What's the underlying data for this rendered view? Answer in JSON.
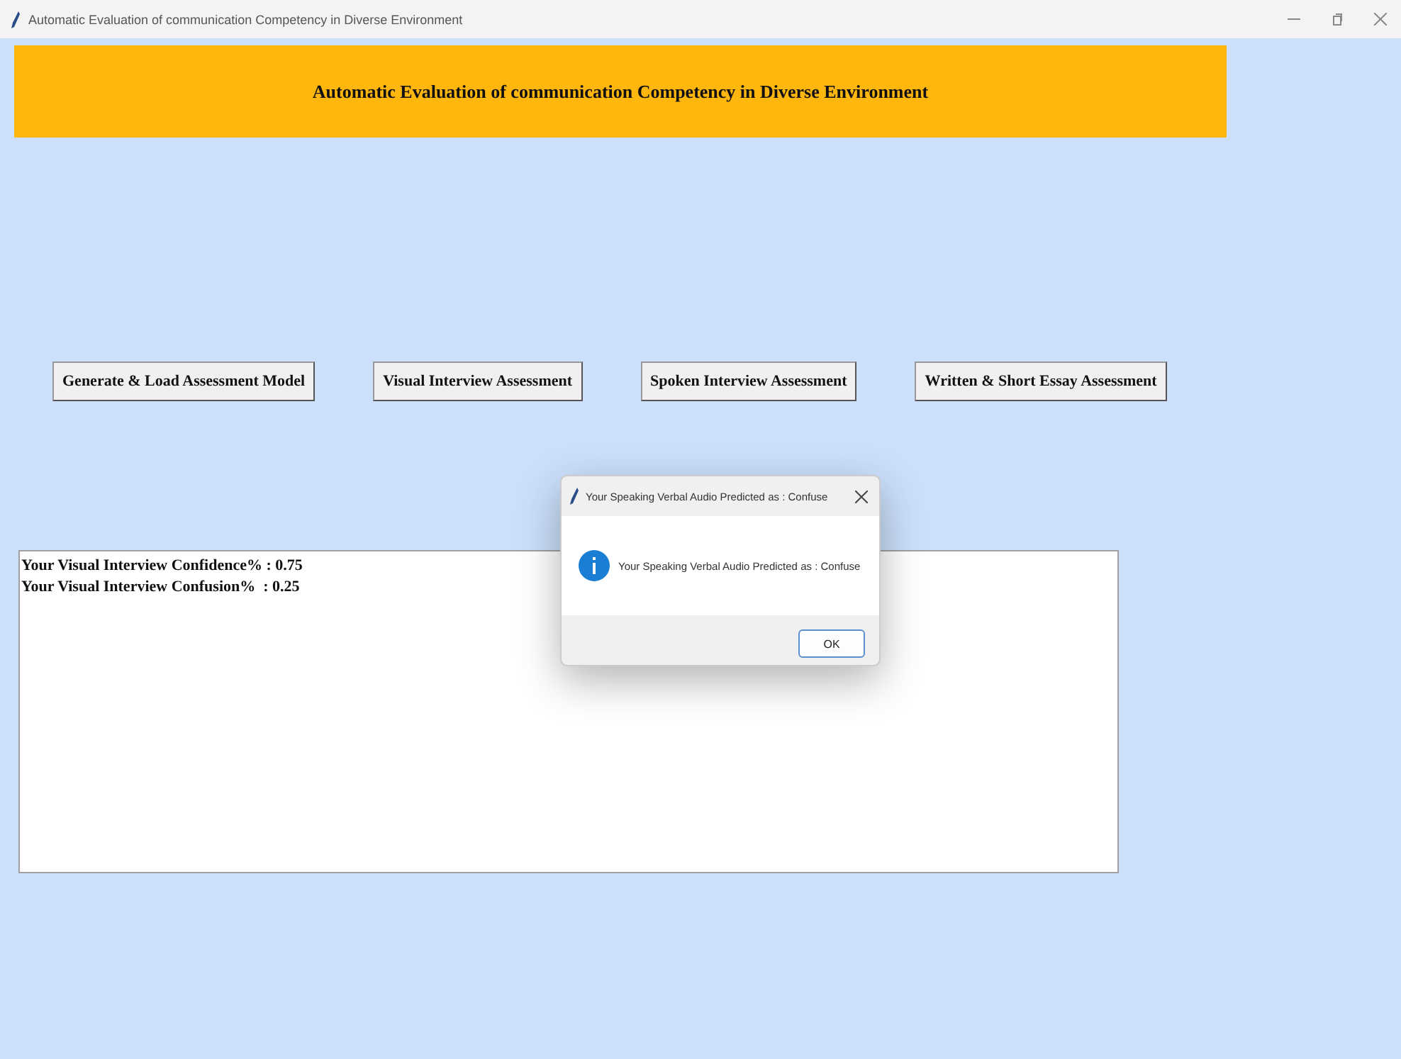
{
  "window": {
    "title": "Automatic Evaluation of communication Competency in Diverse Environment"
  },
  "header": {
    "title": "Automatic Evaluation of communication Competency in Diverse Environment"
  },
  "buttons": [
    "Generate & Load Assessment Model",
    "Visual Interview Assessment",
    "Spoken Interview Assessment",
    "Written & Short Essay Assessment"
  ],
  "output": {
    "lines": [
      "Your Visual Interview Confidence% : 0.75",
      "Your Visual Interview Confusion%  : 0.25"
    ]
  },
  "dialog": {
    "title": "Your Speaking Verbal Audio Predicted as : Confuse",
    "message": "Your Speaking Verbal Audio Predicted as : Confuse",
    "button": "OK"
  }
}
